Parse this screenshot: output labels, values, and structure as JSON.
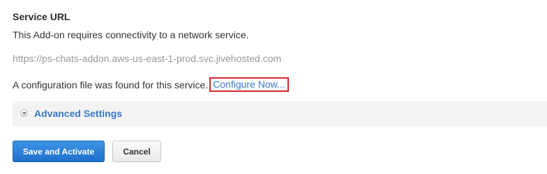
{
  "section": {
    "title": "Service URL",
    "description": "This Add-on requires connectivity to a network service.",
    "url": "https://ps-chats-addon.aws-us-east-1-prod.svc.jivehosted.com"
  },
  "config": {
    "text": "A configuration file was found for this service.",
    "link_label": "Configure Now..."
  },
  "advanced": {
    "label": "Advanced Settings",
    "icon": "chevron-down-circle-icon"
  },
  "buttons": {
    "save_label": "Save and Activate",
    "cancel_label": "Cancel"
  },
  "colors": {
    "link": "#3778c7",
    "highlight_border": "#d7262b",
    "primary_button": "#2a7fd8",
    "panel_background": "#f3f3f3"
  }
}
